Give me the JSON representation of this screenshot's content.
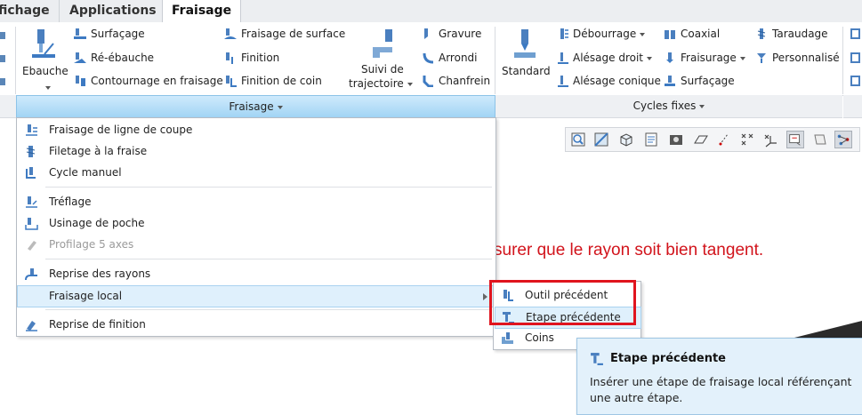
{
  "tabs": [
    "fichage",
    "Applications",
    "Fraisage"
  ],
  "ribbon": {
    "ebauche": "Ebauche",
    "surfacage": "Surfaçage",
    "re_ebauche": "Ré-ébauche",
    "contournage": "Contournage en fraisage",
    "fraisage_surface": "Fraisage de surface",
    "finition": "Finition",
    "finition_coin": "Finition de coin",
    "suivi_line1": "Suivi de",
    "suivi_line2": "trajectoire",
    "gravure": "Gravure",
    "arrondi": "Arrondi",
    "chanfrein": "Chanfrein",
    "standard": "Standard",
    "debourrage": "Débourrage",
    "alesage_droit": "Alésage droit",
    "alesage_conique": "Alésage conique",
    "coaxial": "Coaxial",
    "fraisurage": "Fraisurage",
    "surfacage2": "Surfaçage",
    "taraudage": "Taraudage",
    "personnalise": "Personnalisé"
  },
  "groups": {
    "fraisage": "Fraisage",
    "cycles_fixes": "Cycles fixes"
  },
  "menu": {
    "items": [
      {
        "label": "Fraisage de ligne de coupe"
      },
      {
        "label": "Filetage à la fraise"
      },
      {
        "label": "Cycle manuel"
      },
      {
        "label": "Tréflage"
      },
      {
        "label": "Usinage de poche"
      },
      {
        "label": "Profilage 5 axes"
      },
      {
        "label": "Reprise des rayons"
      },
      {
        "label": "Fraisage local"
      },
      {
        "label": "Reprise de finition"
      }
    ]
  },
  "submenu": {
    "items": [
      {
        "label": "Outil précédent"
      },
      {
        "label": "Etape précédente"
      },
      {
        "label": "Coins"
      }
    ]
  },
  "annotation": "surer que le rayon soit bien tangent.",
  "tooltip": {
    "title": "Etape précédente",
    "body": "Insérer une étape de fraisage local référençant une autre étape."
  },
  "colors": {
    "accent": "#9fd3f4",
    "highlight": "#dff0fc",
    "annotation_red": "#d2141c"
  }
}
